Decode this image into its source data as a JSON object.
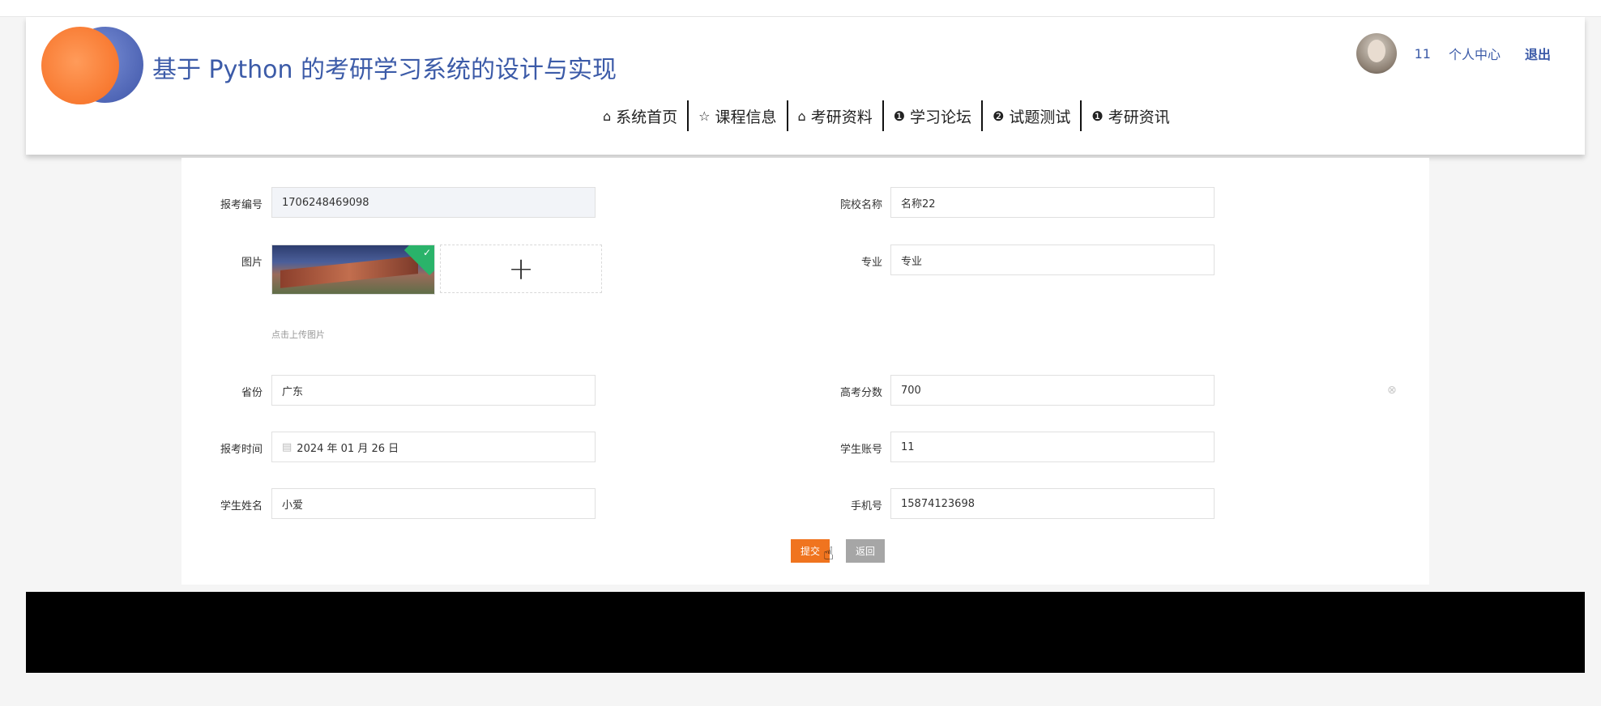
{
  "site": {
    "title": "基于 Python 的考研学习系统的设计与实现"
  },
  "user": {
    "name": "11",
    "center_label": "个人中心",
    "logout_label": "退出"
  },
  "nav": [
    {
      "label": "系统首页",
      "icon": "home-icon",
      "glyph": "⌂"
    },
    {
      "label": "课程信息",
      "icon": "star-icon",
      "glyph": "☆"
    },
    {
      "label": "考研资料",
      "icon": "bag-icon",
      "glyph": "⌂"
    },
    {
      "label": "学习论坛",
      "icon": "alert-icon",
      "glyph": "❶"
    },
    {
      "label": "试题测试",
      "icon": "question-icon",
      "glyph": "❷"
    },
    {
      "label": "考研资讯",
      "icon": "info-icon",
      "glyph": "❶"
    }
  ],
  "form": {
    "exam_no": {
      "label": "报考编号",
      "value": "1706248469098"
    },
    "school_name": {
      "label": "院校名称",
      "value": "名称22"
    },
    "image": {
      "label": "图片",
      "upload_tip": "点击上传图片",
      "upload_glyph": "+"
    },
    "major": {
      "label": "专业",
      "value": "专业"
    },
    "province": {
      "label": "省份",
      "value": "广东"
    },
    "gaokao_score": {
      "label": "高考分数",
      "value": "700"
    },
    "exam_time": {
      "label": "报考时间",
      "value": "2024 年 01 月 26 日"
    },
    "student_account": {
      "label": "学生账号",
      "value": "11"
    },
    "student_name": {
      "label": "学生姓名",
      "value": "小爱"
    },
    "phone": {
      "label": "手机号",
      "value": "15874123698"
    },
    "submit_label": "提交",
    "back_label": "返回"
  },
  "colors": {
    "brand": "#3c5ba8",
    "submit": "#f0741f",
    "back": "#a6a6a6",
    "footer": "#000000"
  }
}
